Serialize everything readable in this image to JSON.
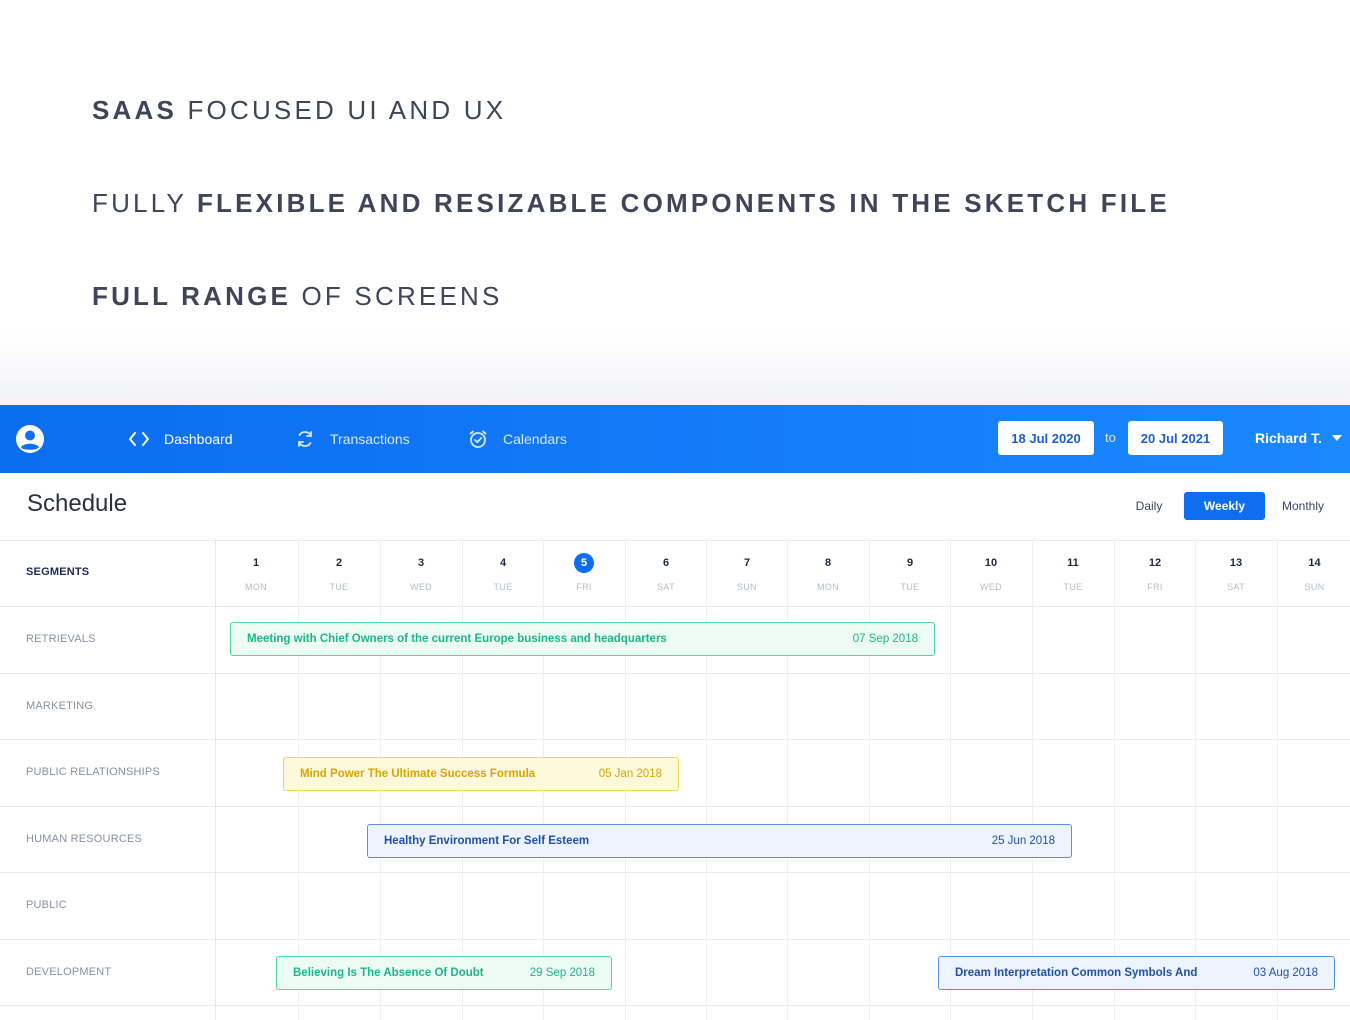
{
  "hero": {
    "line1_bold": "SAAS",
    "line1_rest": " FOCUSED UI AND UX",
    "line2_pre": "FULLY ",
    "line2_bold": "FLEXIBLE AND RESIZABLE COMPONENTS IN THE SKETCH FILE",
    "line3_bold": "FULL RANGE",
    "line3_rest": " OF SCREENS"
  },
  "navbar": {
    "items": [
      {
        "label": "Dashboard",
        "icon": "code-brackets-icon",
        "active": true
      },
      {
        "label": "Transactions",
        "icon": "refresh-icon",
        "active": false
      },
      {
        "label": "Calendars",
        "icon": "alarm-clock-icon",
        "active": false
      }
    ],
    "date_from": "18 Jul 2020",
    "date_to": "20 Jul 2021",
    "to_label": "to",
    "user": "Richard T.",
    "colors": {
      "bar_start": "#0b6df0",
      "bar_end": "#1a88ff"
    }
  },
  "schedule": {
    "title": "Schedule",
    "views": [
      "Daily",
      "Weekly",
      "Monthly"
    ],
    "selected_view": "Weekly",
    "segments_header": "SEGMENTS",
    "days": [
      {
        "num": "1",
        "dow": "MON"
      },
      {
        "num": "2",
        "dow": "TUE"
      },
      {
        "num": "3",
        "dow": "WED"
      },
      {
        "num": "4",
        "dow": "TUE"
      },
      {
        "num": "5",
        "dow": "FRI",
        "today": true
      },
      {
        "num": "6",
        "dow": "SAT"
      },
      {
        "num": "7",
        "dow": "SUN"
      },
      {
        "num": "8",
        "dow": "MON"
      },
      {
        "num": "9",
        "dow": "TUE"
      },
      {
        "num": "10",
        "dow": "WED"
      },
      {
        "num": "11",
        "dow": "TUE"
      },
      {
        "num": "12",
        "dow": "FRI"
      },
      {
        "num": "13",
        "dow": "SAT"
      },
      {
        "num": "14",
        "dow": "SUN"
      }
    ],
    "segments": [
      "RETRIEVALS",
      "MARKETING",
      "PUBLIC RELATIONSHIPS",
      "HUMAN RESOURCES",
      "PUBLIC",
      "DEVELOPMENT"
    ],
    "events": [
      {
        "title": "Meeting with Chief Owners of the current Europe business and headquarters",
        "date": "07 Sep 2018",
        "color": "green"
      },
      {
        "title": "Mind Power The Ultimate Success Formula",
        "date": "05 Jan 2018",
        "color": "yellow"
      },
      {
        "title": "Healthy Environment For Self Esteem",
        "date": "25 Jun 2018",
        "color": "blue"
      },
      {
        "title": "Believing Is The Absence Of Doubt",
        "date": "29 Sep 2018",
        "color": "green"
      },
      {
        "title": "Dream Interpretation Common Symbols And",
        "date": "03 Aug 2018",
        "color": "blue"
      }
    ]
  }
}
